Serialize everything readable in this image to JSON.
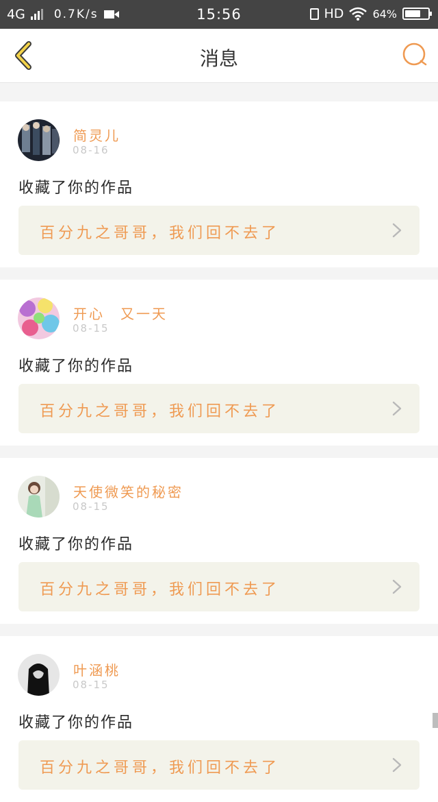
{
  "status_bar": {
    "network": "4G",
    "speed": "0.7K/s",
    "time": "15:56",
    "hd": "HD",
    "battery": "64%"
  },
  "header": {
    "title": "消息",
    "back_icon": "chevron-left-icon",
    "search_icon": "search-icon"
  },
  "colors": {
    "accent": "#ef9a52",
    "card_work_bg": "#f3f3ea",
    "status_bar_bg": "#444444"
  },
  "messages": [
    {
      "user": "简灵儿",
      "date": "08-16",
      "action": "收藏了你的作品",
      "work_title": "百分九之哥哥，我们回不去了"
    },
    {
      "user": "开心　又一天",
      "date": "08-15",
      "action": "收藏了你的作品",
      "work_title": "百分九之哥哥，我们回不去了"
    },
    {
      "user": "天使微笑的秘密",
      "date": "08-15",
      "action": "收藏了你的作品",
      "work_title": "百分九之哥哥，我们回不去了"
    },
    {
      "user": "叶涵桃",
      "date": "08-15",
      "action": "收藏了你的作品",
      "work_title": "百分九之哥哥，我们回不去了"
    }
  ]
}
